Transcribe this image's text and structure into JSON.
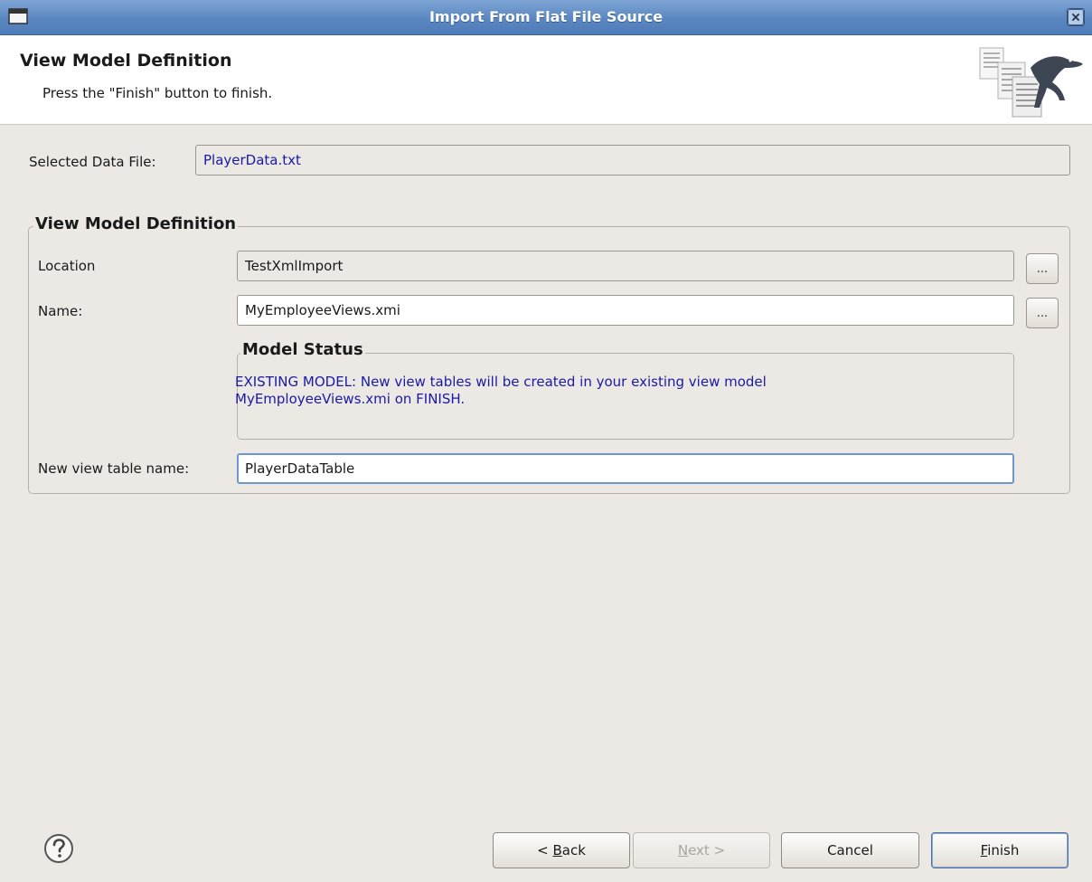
{
  "window": {
    "title": "Import From Flat File Source",
    "app_icon": "window-menu-icon",
    "close_icon": "close-icon"
  },
  "banner": {
    "heading": "View Model Definition",
    "message": "Press the \"Finish\" button to finish.",
    "art_icon": "documents-lizard-icon"
  },
  "data_file": {
    "label": "Selected Data File:",
    "value": "PlayerData.txt"
  },
  "view_model_group": {
    "title": "View Model Definition",
    "location": {
      "label": "Location",
      "value": "TestXmlImport",
      "browse_label": "..."
    },
    "name": {
      "label": "Name:",
      "value": "MyEmployeeViews.xmi",
      "browse_label": "..."
    },
    "model_status": {
      "title": "Model Status",
      "line1": "EXISTING MODEL:  New view tables will be created in your existing view model",
      "line2": "MyEmployeeViews.xmi on FINISH."
    },
    "new_table": {
      "label": "New view table name:",
      "value": "PlayerDataTable"
    }
  },
  "footer": {
    "help_icon": "help-icon",
    "back": {
      "prefix": "< ",
      "mnemonic": "B",
      "rest": "ack"
    },
    "next": {
      "mnemonic": "N",
      "rest": "ext >"
    },
    "cancel": {
      "label": "Cancel"
    },
    "finish": {
      "mnemonic": "F",
      "rest": "inish"
    }
  },
  "colors": {
    "titlebar": "#5b87c1",
    "dialog_bg": "#ece9e4",
    "link_text": "#1a1aa6",
    "focus_border": "#6f97cf"
  }
}
